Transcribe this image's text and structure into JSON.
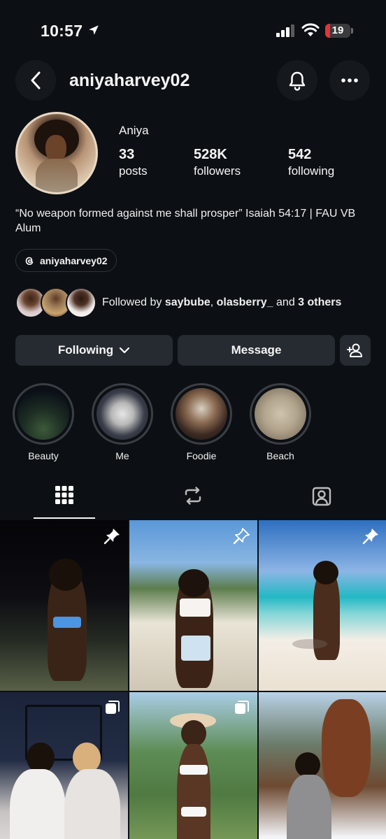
{
  "status_bar": {
    "time": "10:57",
    "battery": "19",
    "battery_level": 0.19,
    "battery_color": "#e3343a"
  },
  "header": {
    "username": "aniyaharvey02",
    "icons": [
      "back-icon",
      "bell-icon",
      "more-icon"
    ]
  },
  "profile": {
    "display_name": "Aniya",
    "stats": [
      {
        "value": "33",
        "label": "posts"
      },
      {
        "value": "528K",
        "label": "followers"
      },
      {
        "value": "542",
        "label": "following"
      }
    ],
    "bio": "“No weapon formed against me shall prosper” Isaiah 54:17 | FAU VB Alum",
    "threads_handle": "aniyaharvey02"
  },
  "followed_by": {
    "prefix": "Followed by ",
    "user1": "saybube",
    "separator": ", ",
    "user2": "olasberry_",
    "conjunction": " and ",
    "others": "3 others"
  },
  "actions": {
    "following_label": "Following",
    "message_label": "Message"
  },
  "highlights": [
    {
      "label": "Beauty"
    },
    {
      "label": "Me"
    },
    {
      "label": "Foodie"
    },
    {
      "label": "Beach"
    }
  ],
  "tabs": [
    "grid-icon",
    "reels-repost-icon",
    "tagged-icon"
  ],
  "posts": [
    {
      "pinned": true,
      "multi": false
    },
    {
      "pinned": true,
      "multi": false
    },
    {
      "pinned": true,
      "multi": false
    },
    {
      "pinned": false,
      "multi": true
    },
    {
      "pinned": false,
      "multi": true
    },
    {
      "pinned": false,
      "multi": false
    }
  ]
}
